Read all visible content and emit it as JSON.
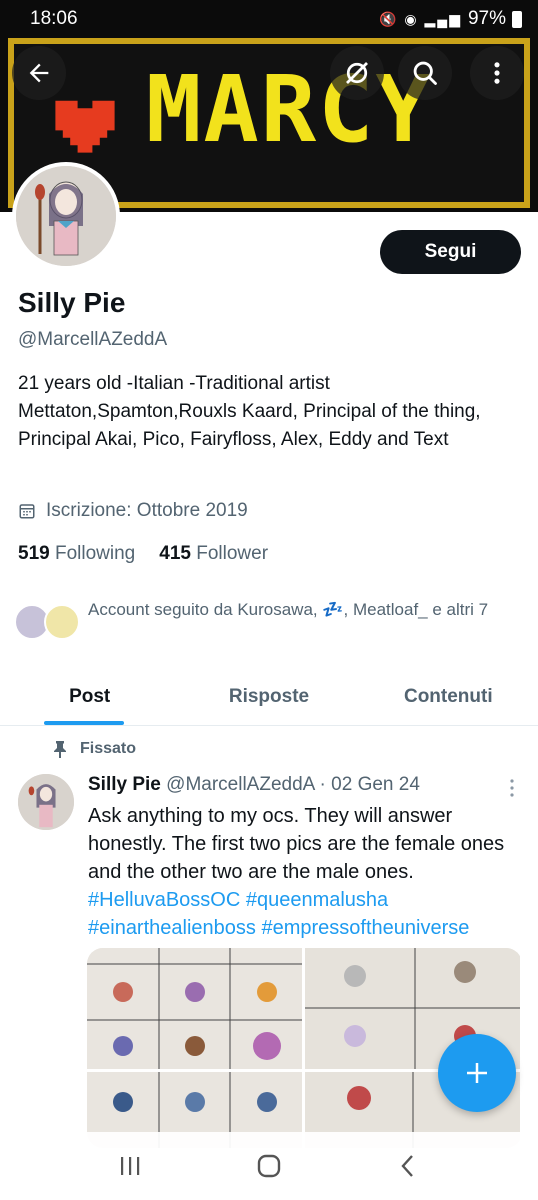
{
  "status_bar": {
    "time": "18:06",
    "battery": "97%"
  },
  "banner": {
    "text": "MARCY"
  },
  "profile": {
    "follow_label": "Segui",
    "name": "Silly Pie",
    "handle": "@MarcellAZeddA",
    "bio": "21 years old -Italian -Traditional artist Mettaton,Spamton,Rouxls Kaard, Principal of the thing, Principal Akai, Pico, Fairyfloss, Alex, Eddy and Text",
    "joined": "Iscrizione: Ottobre 2019",
    "following_count": "519",
    "following_label": "Following",
    "follower_count": "415",
    "follower_label": "Follower",
    "followed_by": "Account seguito da Kurosawa, 💤, Meatloaf_ e altri 7"
  },
  "tabs": [
    {
      "label": "Post",
      "active": true
    },
    {
      "label": "Risposte",
      "active": false
    },
    {
      "label": "Contenuti",
      "active": false
    }
  ],
  "post": {
    "pinned_label": "Fissato",
    "author": "Silly Pie",
    "meta": "@MarcellAZeddA · 02 Gen 24",
    "text": "Ask anything to my ocs. They will answer honestly. The first two pics are the female ones and the other two are the male ones.",
    "hashtags": "#HelluvaBossOC #queenmalusha #einarthealienboss #empressoftheuniverse"
  },
  "colors": {
    "accent": "#1d9bf0",
    "text": "#0f1419",
    "muted": "#536471"
  },
  "icons": {
    "back": "arrow-left-icon",
    "mute": "mute-icon",
    "search": "search-icon",
    "more": "more-vertical-icon",
    "calendar": "calendar-icon",
    "pin": "pin-icon",
    "compose": "plus-icon"
  }
}
